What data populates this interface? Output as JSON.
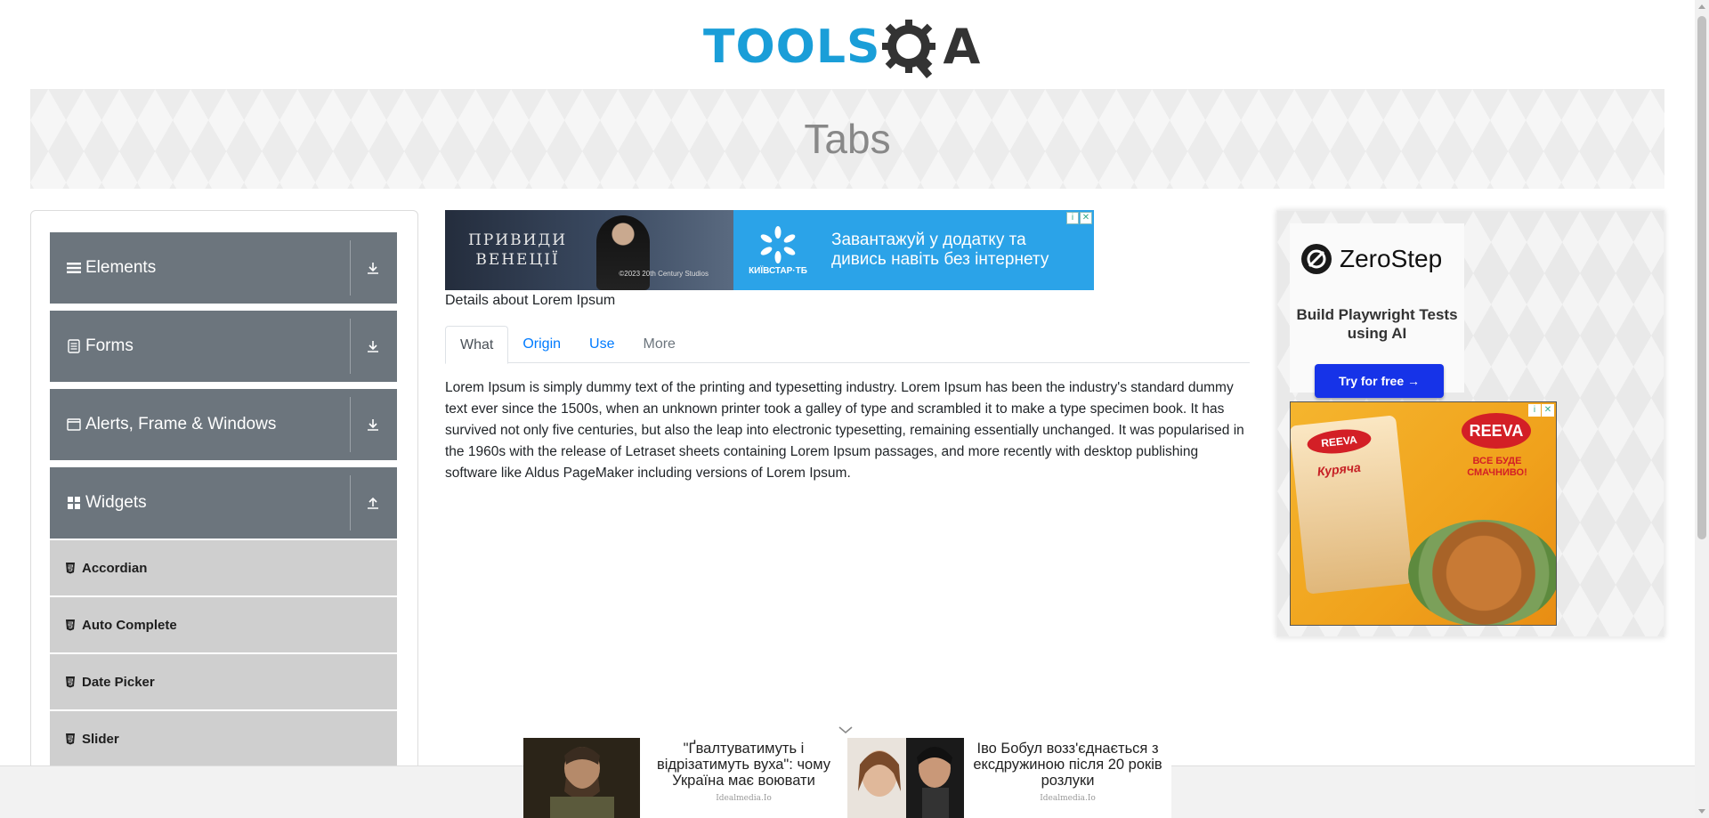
{
  "logo": {
    "text_main": "TOOLS",
    "text_q": "Q",
    "text_a": "A"
  },
  "banner": {
    "title": "Tabs"
  },
  "sidebar": {
    "groups": [
      {
        "label": "Elements",
        "icon": "hamburger-icon",
        "arrow": "download-arrow-icon"
      },
      {
        "label": "Forms",
        "icon": "document-icon",
        "arrow": "download-arrow-icon"
      },
      {
        "label": "Alerts, Frame & Windows",
        "icon": "window-icon",
        "arrow": "download-arrow-icon"
      },
      {
        "label": "Widgets",
        "icon": "grid-icon",
        "arrow": "upload-arrow-icon"
      }
    ],
    "widget_items": [
      {
        "label": "Accordian"
      },
      {
        "label": "Auto Complete"
      },
      {
        "label": "Date Picker"
      },
      {
        "label": "Slider"
      }
    ]
  },
  "top_ad": {
    "left_title": "ПРИВИДИ\nВЕНЕЦІЇ",
    "left_copyright": "©2023 20th Century Studios",
    "brand": "КИЇВСТАР·ТБ",
    "message": "Завантажуй у додатку та\nдивись навіть без інтернету"
  },
  "main": {
    "details": "Details about Lorem Ipsum",
    "tabs": [
      {
        "label": "What",
        "state": "active"
      },
      {
        "label": "Origin",
        "state": "normal"
      },
      {
        "label": "Use",
        "state": "normal"
      },
      {
        "label": "More",
        "state": "disabled"
      }
    ],
    "content": "Lorem Ipsum is simply dummy text of the printing and typesetting industry. Lorem Ipsum has been the industry's standard dummy text ever since the 1500s, when an unknown printer took a galley of type and scrambled it to make a type specimen book. It has survived not only five centuries, but also the leap into electronic typesetting, remaining essentially unchanged. It was popularised in the 1960s with the release of Letraset sheets containing Lorem Ipsum passages, and more recently with desktop publishing software like Aldus PageMaker including versions of Lorem Ipsum."
  },
  "zerostep_ad": {
    "brand": "ZeroStep",
    "tagline": "Build Playwright Tests using AI",
    "button": "Try for free →"
  },
  "reeva_ad": {
    "brand": "REEVA",
    "slogan": "ВСЕ БУДЕ СМАЧНИВО!",
    "pack_name": "Куряча"
  },
  "sticky_ad": {
    "cards": [
      {
        "headline": "\"Ґвалтуватимуть і відрізатимуть вуха\": чому Україна має воювати",
        "source": "Idealmedia.Io"
      },
      {
        "headline": "Іво Бобул возз'єднається з ексдружиною після 20 років розлуки",
        "source": "Idealmedia.Io"
      }
    ]
  },
  "colors": {
    "logo_blue": "#1a9ed8",
    "sidebar_group": "#6c757d",
    "sidebar_item": "#cfcfcf",
    "link_blue": "#007bff",
    "zerostep_button": "#1633e8"
  }
}
